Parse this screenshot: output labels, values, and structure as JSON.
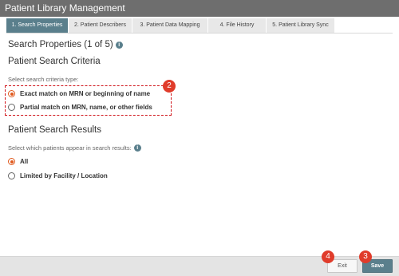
{
  "window": {
    "title": "Patient Library Management"
  },
  "tabs": [
    {
      "label": "1. Search Properties",
      "active": true
    },
    {
      "label": "2. Patient Describers",
      "active": false
    },
    {
      "label": "3. Patient Data Mapping",
      "active": false
    },
    {
      "label": "4. File History",
      "active": false
    },
    {
      "label": "5. Patient Library Sync",
      "active": false
    }
  ],
  "main": {
    "heading": "Search Properties (1 of 5)",
    "criteria": {
      "title": "Patient Search Criteria",
      "prompt": "Select search criteria type:",
      "options": [
        {
          "label": "Exact match on MRN or beginning of name",
          "checked": true
        },
        {
          "label": "Partial match on MRN, name, or other fields",
          "checked": false
        }
      ]
    },
    "results": {
      "title": "Patient Search Results",
      "prompt": "Select which patients appear in search results:",
      "options": [
        {
          "label": "All",
          "checked": true
        },
        {
          "label": "Limited by Facility / Location",
          "checked": false
        }
      ]
    }
  },
  "annotations": {
    "criteria_badge": "2",
    "save_badge": "3",
    "exit_badge": "4"
  },
  "footer": {
    "exit_label": "Exit",
    "save_label": "Save"
  },
  "colors": {
    "accent": "#5a7f8c",
    "radio_selected": "#e05a1e",
    "annotation": "#e03c2b"
  }
}
